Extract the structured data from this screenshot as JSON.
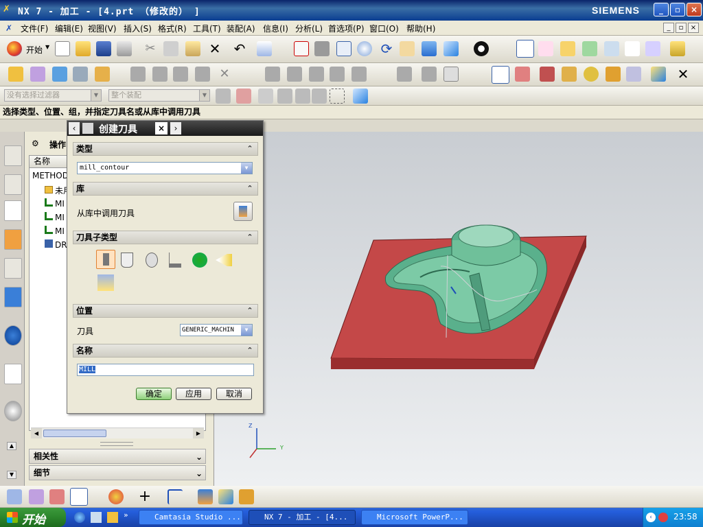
{
  "window": {
    "title": "NX 7 - 加工 - [4.prt （修改的） ]",
    "brand": "SIEMENS",
    "minimize": "_",
    "restore": "▫",
    "close": "×"
  },
  "menu": {
    "items": [
      "文件(F)",
      "编辑(E)",
      "视图(V)",
      "插入(S)",
      "格式(R)",
      "工具(T)",
      "装配(A)",
      "信息(I)",
      "分析(L)",
      "首选项(P)",
      "窗口(O)",
      "帮助(H)"
    ]
  },
  "toolbar": {
    "start_label": "开始"
  },
  "filter": {
    "type_filter": "没有选择过滤器",
    "scope": "整个装配"
  },
  "cue": "选择类型、位置、组，并指定刀具名或从库中调用刀具",
  "navigator": {
    "header": "操作",
    "column_name": "名称",
    "rows": [
      {
        "label": "METHOD"
      },
      {
        "label": "未用"
      },
      {
        "label": "MI"
      },
      {
        "label": "MI"
      },
      {
        "label": "MI"
      },
      {
        "label": "DR"
      }
    ],
    "panel_dependencies": "相关性",
    "panel_details": "细节"
  },
  "dialog": {
    "title": "创建刀具",
    "section_type": "类型",
    "type_value": "mill_contour",
    "section_library": "库",
    "library_label": "从库中调用刀具",
    "section_subtype": "刀具子类型",
    "section_location": "位置",
    "tool_label": "刀具",
    "tool_value": "GENERIC_MACHIN",
    "section_name": "名称",
    "name_value": "MILL",
    "ok": "确定",
    "apply": "应用",
    "cancel": "取消"
  },
  "axes": {
    "z": "Z",
    "y": "Y"
  },
  "taskbar": {
    "start": "开始",
    "tasks": [
      "Camtasia Studio ...",
      "NX 7 - 加工 - [4...",
      "Microsoft PowerP..."
    ],
    "clock": "23:58"
  }
}
